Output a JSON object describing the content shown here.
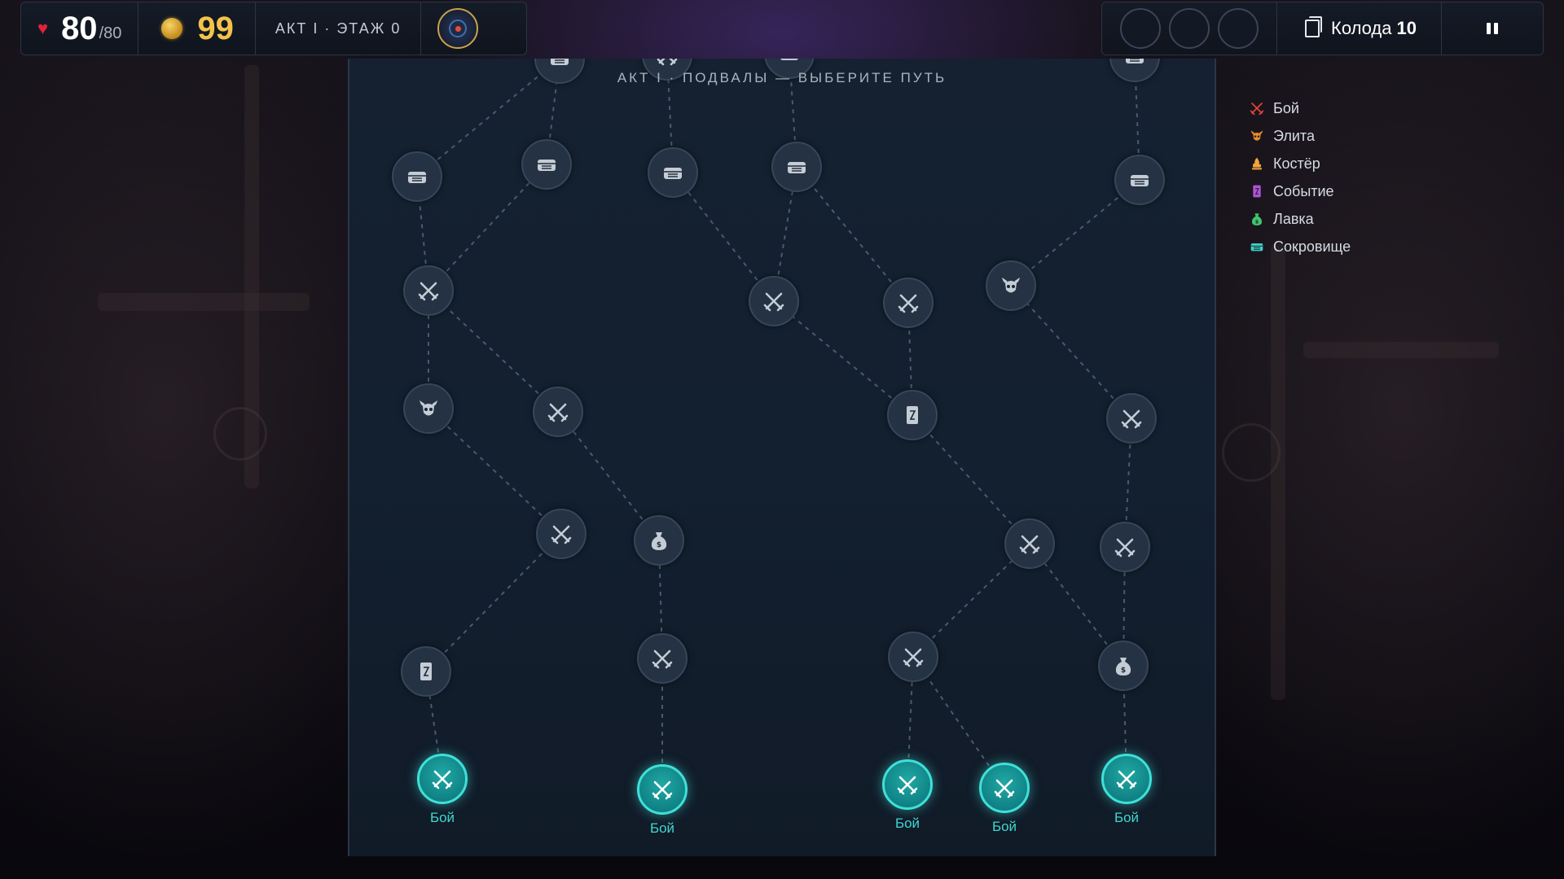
{
  "hud": {
    "hp_current": "80",
    "hp_max": "/80",
    "gold": "99",
    "act_floor": "АКТ I · ЭТАЖ 0",
    "deck_label": "Колода",
    "deck_count": "10",
    "potion_slots": 3
  },
  "map": {
    "title": "АКТ I · ПОДВАЛЫ — ВЫБЕРИТЕ ПУТЬ",
    "available_label": "Бой",
    "nodes": [
      {
        "id": "t1",
        "type": "treasure",
        "state": "partial"
      },
      {
        "id": "t2",
        "type": "combat",
        "state": "partial"
      },
      {
        "id": "t3",
        "type": "treasure",
        "state": "partial"
      },
      {
        "id": "t4",
        "type": "treasure",
        "state": "partial"
      },
      {
        "id": "a1",
        "type": "treasure"
      },
      {
        "id": "a2",
        "type": "treasure"
      },
      {
        "id": "a3",
        "type": "treasure"
      },
      {
        "id": "a4",
        "type": "treasure"
      },
      {
        "id": "a5",
        "type": "treasure"
      },
      {
        "id": "b1",
        "type": "combat"
      },
      {
        "id": "b2",
        "type": "combat"
      },
      {
        "id": "b3",
        "type": "combat"
      },
      {
        "id": "b4",
        "type": "elite"
      },
      {
        "id": "c1",
        "type": "elite"
      },
      {
        "id": "c2",
        "type": "combat"
      },
      {
        "id": "c3",
        "type": "event"
      },
      {
        "id": "c4",
        "type": "combat"
      },
      {
        "id": "d1",
        "type": "combat"
      },
      {
        "id": "d2",
        "type": "shop"
      },
      {
        "id": "d3",
        "type": "combat"
      },
      {
        "id": "d4",
        "type": "combat"
      },
      {
        "id": "e1",
        "type": "event"
      },
      {
        "id": "e2",
        "type": "combat"
      },
      {
        "id": "e3",
        "type": "combat"
      },
      {
        "id": "e4",
        "type": "shop"
      },
      {
        "id": "s1",
        "type": "combat",
        "state": "available"
      },
      {
        "id": "s2",
        "type": "combat",
        "state": "available"
      },
      {
        "id": "s3",
        "type": "combat",
        "state": "available"
      },
      {
        "id": "s4",
        "type": "combat",
        "state": "available"
      },
      {
        "id": "s5",
        "type": "combat",
        "state": "available"
      }
    ],
    "edges": [
      [
        "s1",
        "e1"
      ],
      [
        "e1",
        "d1"
      ],
      [
        "d1",
        "c1"
      ],
      [
        "c1",
        "b1"
      ],
      [
        "b1",
        "a1"
      ],
      [
        "a1",
        "t1"
      ],
      [
        "s2",
        "e2"
      ],
      [
        "e2",
        "d2"
      ],
      [
        "d2",
        "c2"
      ],
      [
        "c2",
        "b1"
      ],
      [
        "b1",
        "a2"
      ],
      [
        "a2",
        "t1"
      ],
      [
        "s3",
        "e3"
      ],
      [
        "e3",
        "d3"
      ],
      [
        "d3",
        "c3"
      ],
      [
        "c3",
        "b2"
      ],
      [
        "b2",
        "a3"
      ],
      [
        "a3",
        "t2"
      ],
      [
        "s4",
        "e3"
      ],
      [
        "c3",
        "b3"
      ],
      [
        "b3",
        "a4"
      ],
      [
        "a4",
        "t3"
      ],
      [
        "b2",
        "a4"
      ],
      [
        "s5",
        "e4"
      ],
      [
        "e4",
        "d3"
      ],
      [
        "e4",
        "d4"
      ],
      [
        "d4",
        "c4"
      ],
      [
        "c4",
        "b4"
      ],
      [
        "b4",
        "a5"
      ],
      [
        "a5",
        "t4"
      ]
    ]
  },
  "legend": [
    {
      "label": "Бой",
      "icon": "crossed-swords-icon",
      "color": "#e0443a"
    },
    {
      "label": "Элита",
      "icon": "horned-skull-icon",
      "color": "#f08a2a"
    },
    {
      "label": "Костёр",
      "icon": "campfire-icon",
      "color": "#f2a33a"
    },
    {
      "label": "Событие",
      "icon": "scroll-icon",
      "color": "#b054d6"
    },
    {
      "label": "Лавка",
      "icon": "money-bag-icon",
      "color": "#43c46b"
    },
    {
      "label": "Сокровище",
      "icon": "chest-icon",
      "color": "#3ecfc4"
    }
  ]
}
